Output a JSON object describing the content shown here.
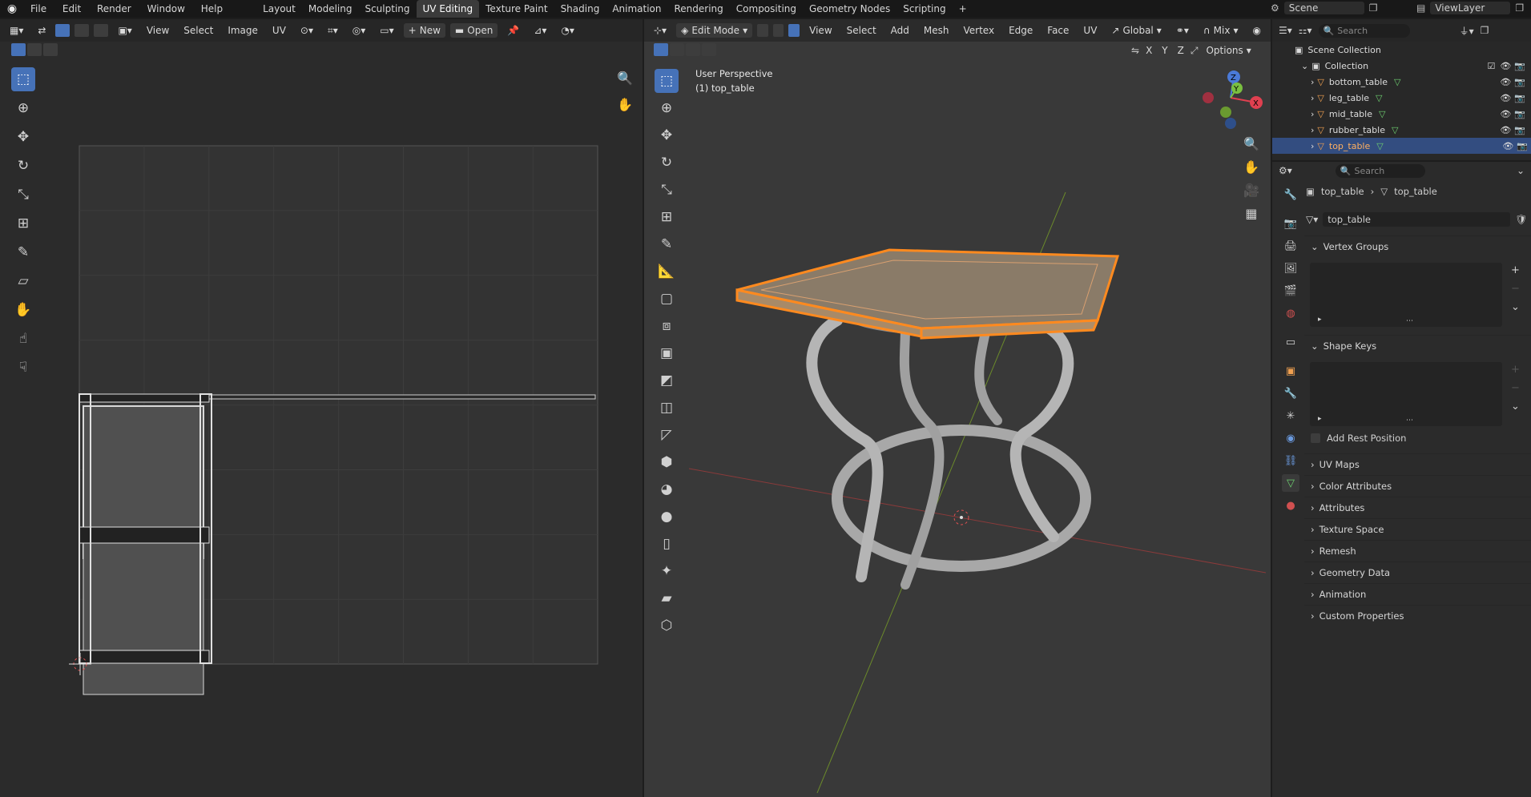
{
  "topbar": {
    "menus": [
      "File",
      "Edit",
      "Render",
      "Window",
      "Help"
    ],
    "workspaces": [
      "Layout",
      "Modeling",
      "Sculpting",
      "UV Editing",
      "Texture Paint",
      "Shading",
      "Animation",
      "Rendering",
      "Compositing",
      "Geometry Nodes",
      "Scripting"
    ],
    "active_workspace": "UV Editing",
    "scene": "Scene",
    "viewlayer": "ViewLayer"
  },
  "uv_editor": {
    "menus": [
      "View",
      "Select",
      "Image",
      "UV"
    ],
    "new_label": "New",
    "open_label": "Open"
  },
  "viewport": {
    "mode": "Edit Mode",
    "menus": [
      "View",
      "Select",
      "Add",
      "Mesh",
      "Vertex",
      "Edge",
      "Face",
      "UV"
    ],
    "transform": "Global",
    "snap": "Mix",
    "options": "Options",
    "perspective": "User Perspective",
    "object_info": "(1) top_table",
    "axes": [
      "X",
      "Y",
      "Z"
    ]
  },
  "outliner": {
    "search_placeholder": "Search",
    "scene_collection": "Scene Collection",
    "collection": "Collection",
    "objects": [
      "bottom_table",
      "leg_table",
      "mid_table",
      "rubber_table",
      "top_table"
    ],
    "selected": "top_table"
  },
  "properties": {
    "search_placeholder": "Search",
    "breadcrumb_object": "top_table",
    "breadcrumb_mesh": "top_table",
    "mesh_name": "top_table",
    "sections": {
      "vertex_groups": "Vertex Groups",
      "shape_keys": "Shape Keys",
      "add_rest_position": "Add Rest Position",
      "uv_maps": "UV Maps",
      "color_attributes": "Color Attributes",
      "attributes": "Attributes",
      "texture_space": "Texture Space",
      "remesh": "Remesh",
      "geometry_data": "Geometry Data",
      "animation": "Animation",
      "custom_properties": "Custom Properties"
    }
  },
  "colors": {
    "accent": "#4672b8",
    "selection": "#ff8a1f",
    "header": "#262626",
    "panel": "#303030"
  }
}
